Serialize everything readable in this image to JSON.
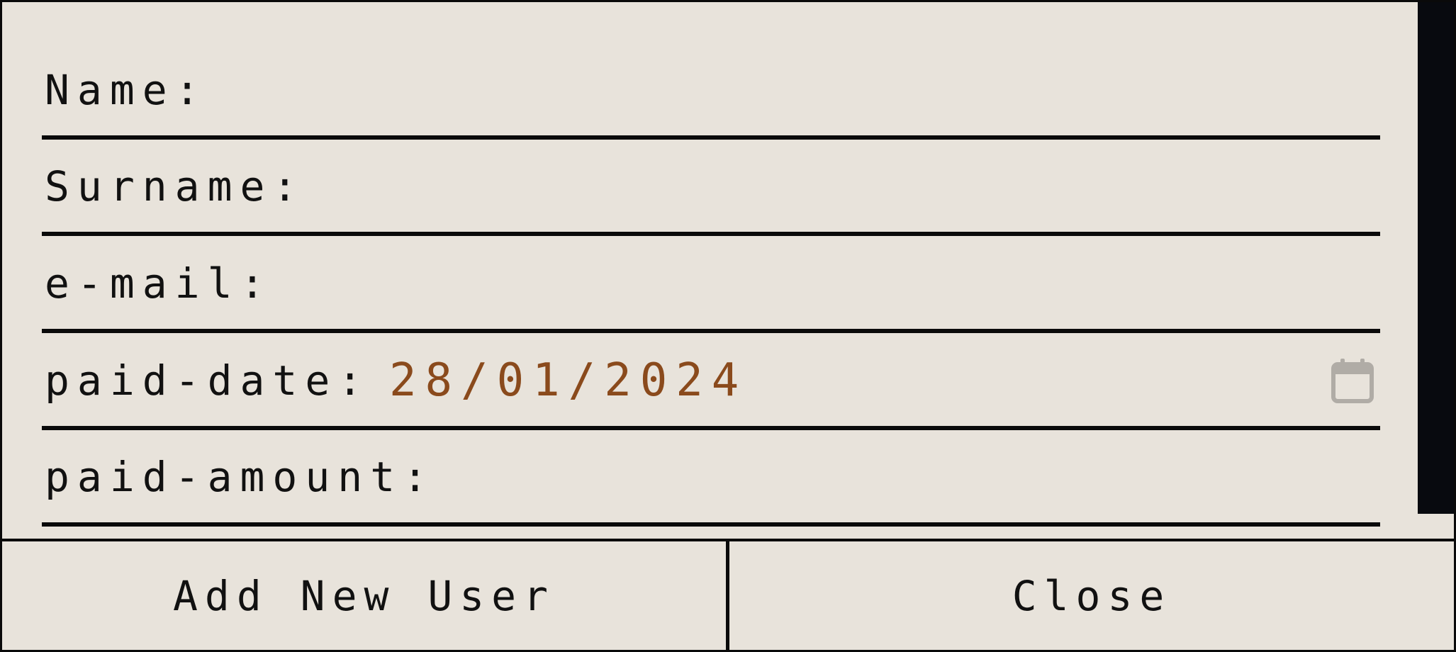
{
  "form": {
    "fields": [
      {
        "label": "Name:",
        "value": ""
      },
      {
        "label": "Surname:",
        "value": ""
      },
      {
        "label": "e-mail:",
        "value": ""
      },
      {
        "label": "paid-date:",
        "value": "28/01/2024",
        "icon": "calendar-icon"
      },
      {
        "label": "paid-amount:",
        "value": ""
      }
    ]
  },
  "buttons": {
    "add_new_user": "Add New User",
    "close": "Close"
  },
  "colors": {
    "background": "#e8e3db",
    "border": "#0a0a0a",
    "date_value": "#8a4a1c",
    "scrollbar": "#080a0f",
    "calendar_icon": "#b0aca6"
  }
}
